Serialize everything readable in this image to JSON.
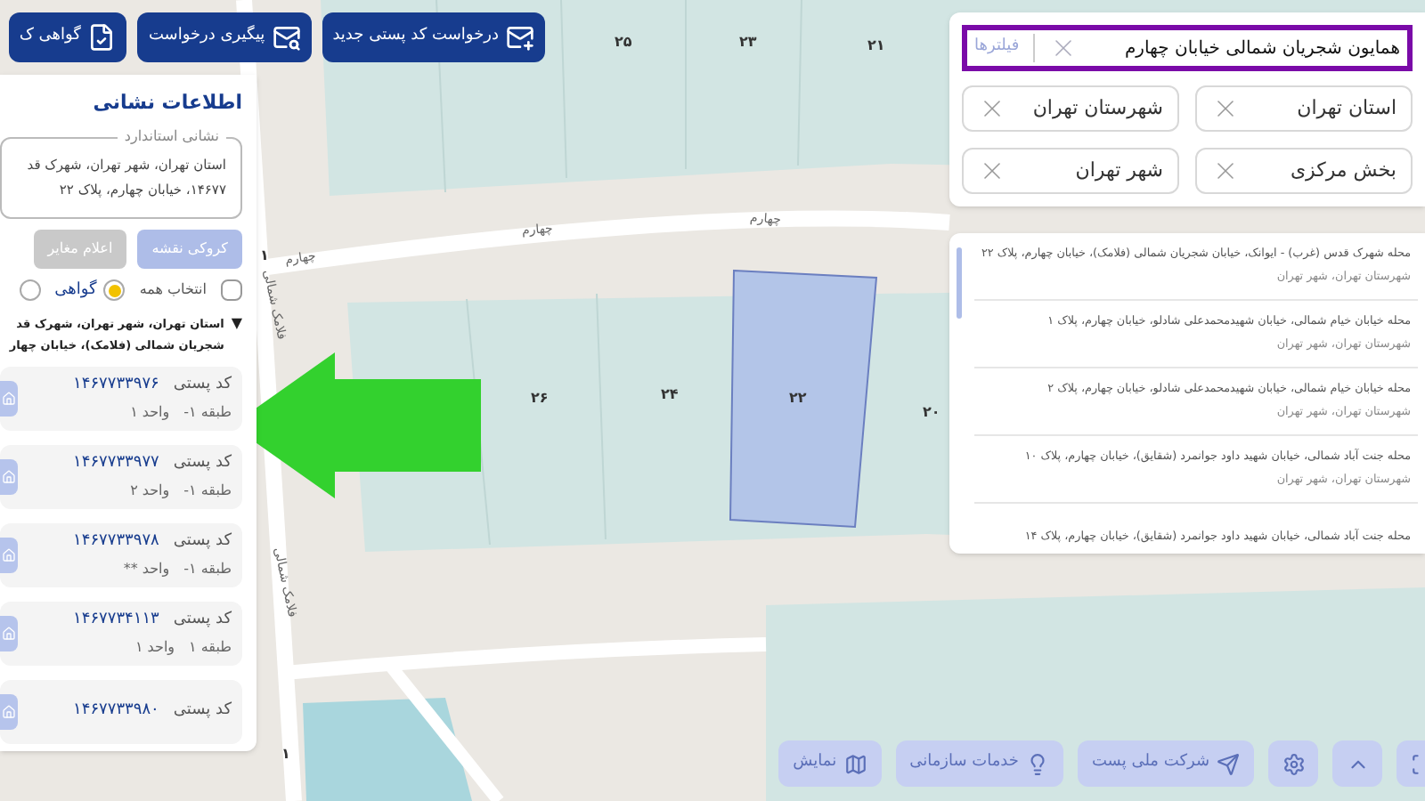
{
  "top_buttons": [
    {
      "label": "درخواست کد پستی جدید"
    },
    {
      "label": "پیگیری درخواست"
    },
    {
      "label": "گواهی ک"
    }
  ],
  "map": {
    "labels": [
      {
        "text": "۲۱",
        "kind": "plot"
      },
      {
        "text": "۲۳",
        "kind": "plot"
      },
      {
        "text": "۲۵",
        "kind": "plot"
      },
      {
        "text": "۲۰",
        "kind": "plot"
      },
      {
        "text": "۲۲",
        "kind": "plot"
      },
      {
        "text": "۲۴",
        "kind": "plot"
      },
      {
        "text": "۲۶",
        "kind": "plot"
      },
      {
        "text": "چهارم",
        "kind": "street"
      },
      {
        "text": "چهارم",
        "kind": "street"
      },
      {
        "text": "چهارم",
        "kind": "street"
      },
      {
        "text": "فلامک شمالی",
        "kind": "street"
      },
      {
        "text": "فلامک شمالی",
        "kind": "street"
      },
      {
        "text": "۱",
        "kind": "plot"
      },
      {
        "text": "۱",
        "kind": "plot"
      }
    ]
  },
  "address_panel": {
    "title": "اطلاعات نشانی",
    "legend": "نشانی استاندارد",
    "address_lines": [
      "استان تهران، شهر تهران، شهرک قد",
      "۱۴۶۷۷، خیابان چهارم، پلاک ۲۲"
    ],
    "actions": [
      {
        "label": "کروکی نقشه",
        "kind": "primary",
        "disabled": true
      },
      {
        "label": "اعلام مغایر",
        "kind": "secondary",
        "disabled": true
      }
    ],
    "select_all": {
      "label": "انتخاب همه",
      "checked": false
    },
    "radios": [
      {
        "label": "گواهی",
        "selected": true
      },
      {
        "selected": false
      }
    ],
    "group": {
      "expanded": true,
      "toggle": "▼",
      "lines": [
        "استان تهران، شهر تهران، شهرک قد",
        "شجریان شمالی (فلامک)، خیابان چهار"
      ]
    },
    "postcodes": [
      {
        "label": "کد پستی",
        "code": "۱۴۶۷۷۳۳۹۷۶",
        "floor": "طبقه ۱-",
        "unit": "واحد ۱"
      },
      {
        "label": "کد پستی",
        "code": "۱۴۶۷۷۳۳۹۷۷",
        "floor": "طبقه ۱-",
        "unit": "واحد ۲"
      },
      {
        "label": "کد پستی",
        "code": "۱۴۶۷۷۳۳۹۷۸",
        "floor": "طبقه ۱-",
        "unit": "واحد **"
      },
      {
        "label": "کد پستی",
        "code": "۱۴۶۷۷۳۴۱۱۳",
        "floor": "طبقه ۱",
        "unit": "واحد ۱"
      },
      {
        "label": "کد پستی",
        "code": "۱۴۶۷۷۳۳۹۸۰"
      }
    ]
  },
  "search": {
    "value": "همایون شجریان شمالی خیابان چهارم",
    "filters_label": "فیلترها",
    "chips": [
      {
        "label": "استان تهران"
      },
      {
        "label": "شهرستان تهران"
      },
      {
        "label": "بخش مرکزی"
      },
      {
        "label": "شهر تهران"
      }
    ]
  },
  "results": [
    {
      "title": "محله شهرک قدس (غرب) - ایوانک، خیابان شجریان شمالی (فلامک)، خیابان چهارم، پلاک ۲۲",
      "subtitle": "شهرستان تهران، شهر تهران"
    },
    {
      "title": "محله خیابان خیام شمالی، خیابان شهیدمحمدعلی شادلو، خیابان چهارم، پلاک ۱",
      "subtitle": "شهرستان تهران، شهر تهران"
    },
    {
      "title": "محله خیابان خیام شمالی، خیابان شهیدمحمدعلی شادلو، خیابان چهارم، پلاک ۲",
      "subtitle": "شهرستان تهران، شهر تهران"
    },
    {
      "title": "محله جنت آباد شمالی، خیابان شهید داود جوانمرد (شقایق)، خیابان چهارم، پلاک ۱۰",
      "subtitle": "شهرستان تهران، شهر تهران"
    },
    {
      "title": "محله جنت آباد شمالی، خیابان شهید داود جوانمرد (شقایق)، خیابان چهارم، پلاک ۱۴"
    }
  ],
  "toolbar": [
    {
      "kind": "icon"
    },
    {
      "kind": "icon"
    },
    {
      "kind": "icon"
    },
    {
      "kind": "text",
      "label": "شرکت ملی پست"
    },
    {
      "kind": "text",
      "label": "خدمات سازمانی"
    },
    {
      "kind": "text",
      "label": "نمایش"
    }
  ]
}
